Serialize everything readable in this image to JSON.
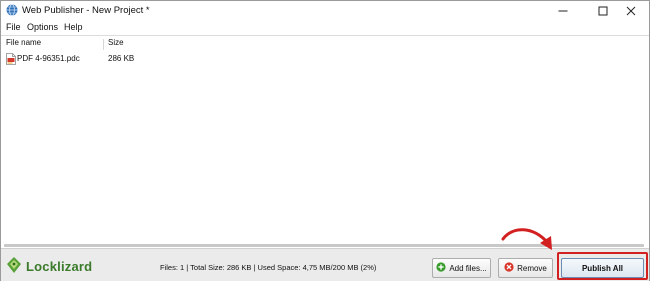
{
  "window": {
    "title": "Web Publisher - New Project *",
    "controls": {
      "minimize": "minimize-icon",
      "maximize": "maximize-icon",
      "close": "close-icon"
    }
  },
  "menu": {
    "items": [
      {
        "label": "File"
      },
      {
        "label": "Options"
      },
      {
        "label": "Help"
      }
    ]
  },
  "file_list": {
    "columns": [
      {
        "label": "File name"
      },
      {
        "label": "Size"
      }
    ],
    "rows": [
      {
        "name": "PDF 4-96351.pdc",
        "size": "286 KB",
        "icon": "pdc-file-icon"
      }
    ]
  },
  "footer": {
    "logo_text": "Locklizard",
    "status": "Files: 1 | Total Size: 286 KB | Used Space: 4,75 MB/200 MB (2%)",
    "buttons": {
      "add_files": "Add files...",
      "remove": "Remove",
      "publish_all": "Publish All"
    }
  },
  "annotation": {
    "highlight_color": "#d21f1f",
    "arrow_color": "#d21f1f"
  },
  "colors": {
    "logo_green": "#3a7a2a",
    "add_icon_green": "#3b9c2e",
    "remove_icon_red": "#d9362b"
  }
}
